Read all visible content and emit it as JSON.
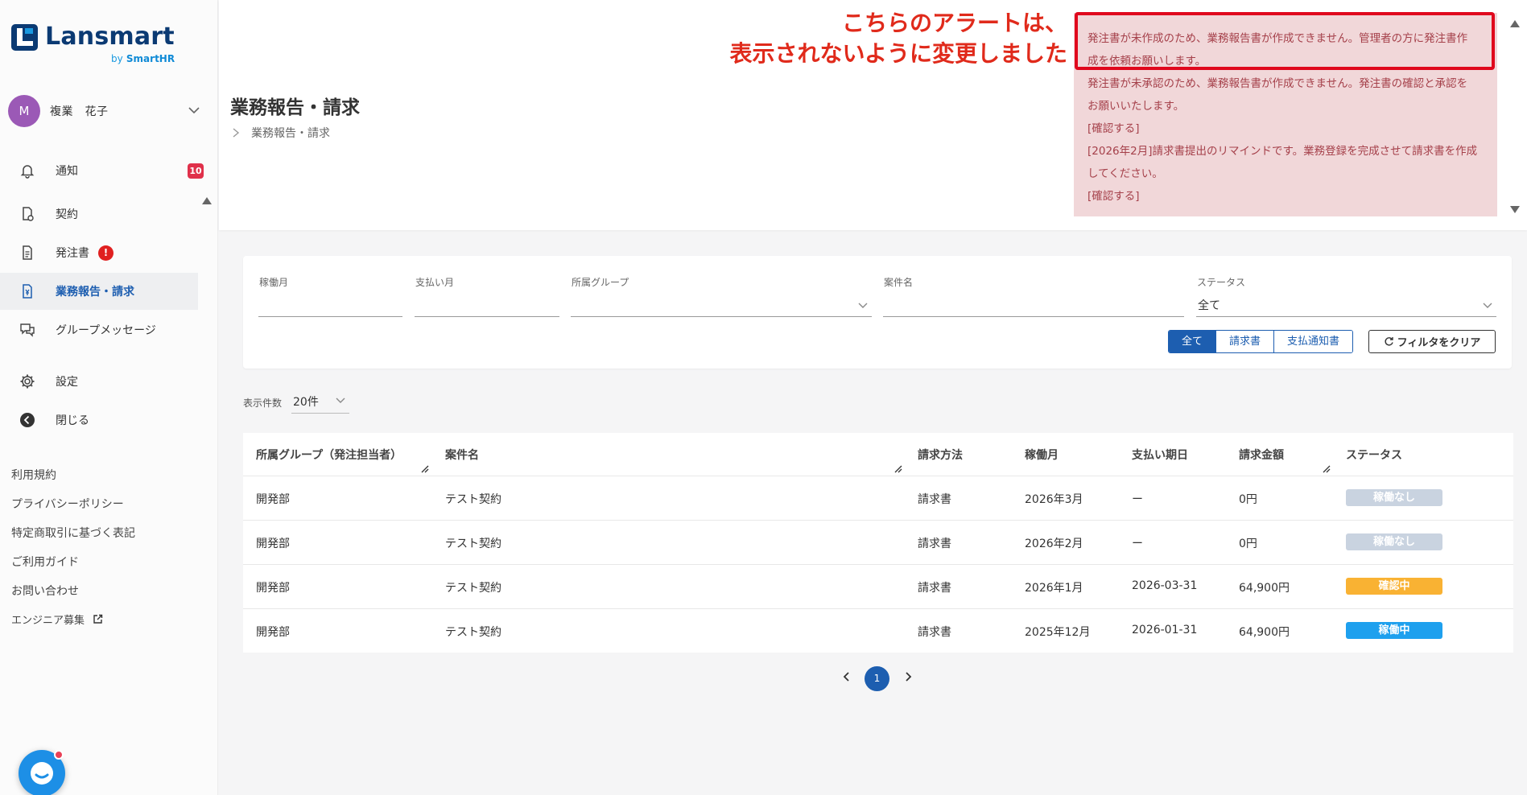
{
  "brand": {
    "name": "Lansmart",
    "sub_prefix": "by",
    "sub_name": "SmartHR",
    "color": "#0b3a73"
  },
  "user": {
    "initial": "M",
    "name": "複業　花子",
    "avatar_color": "#9b59b6"
  },
  "nav": {
    "notifications": {
      "label": "通知",
      "badge": "10"
    },
    "contracts": {
      "label": "契約"
    },
    "orders": {
      "label": "発注書",
      "badge": "!"
    },
    "reports": {
      "label": "業務報告・請求"
    },
    "group_messages": {
      "label": "グループメッセージ"
    },
    "settings": {
      "label": "設定"
    },
    "close": {
      "label": "閉じる"
    }
  },
  "footer_links": {
    "terms": "利用規約",
    "privacy": "プライバシーポリシー",
    "commerce": "特定商取引に基づく表記",
    "guide": "ご利用ガイド",
    "contact": "お問い合わせ",
    "engineers": "エンジニア募集"
  },
  "page": {
    "title": "業務報告・請求",
    "breadcrumb": "業務報告・請求"
  },
  "annotation": {
    "line1": "こちらのアラートは、",
    "line2": "表示されないように変更しました",
    "color": "#e02a1b"
  },
  "alerts": {
    "a1_line1": "発注書が未作成のため、業務報告書が作成できません。管理者の方に発注書作",
    "a1_line2": "成を依頼お願いします。",
    "a2_line1": "発注書が未承認のため、業務報告書が作成できません。発注書の確認と承認を",
    "a2_line2": "お願いいたします。",
    "a2_link": "[確認する]",
    "a3_line1": "[2026年2月]請求書提出のリマインドです。業務登録を完成させて請求書を作成",
    "a3_line2": "してください。",
    "a3_link": "[確認する]"
  },
  "filters": {
    "work_month": {
      "label": "稼働月",
      "value": ""
    },
    "pay_month": {
      "label": "支払い月",
      "value": ""
    },
    "group": {
      "label": "所属グループ",
      "value": ""
    },
    "project": {
      "label": "案件名",
      "value": ""
    },
    "status": {
      "label": "ステータス",
      "value": "全て"
    }
  },
  "segments": {
    "all": "全て",
    "invoice": "請求書",
    "payment_notice": "支払通知書"
  },
  "clear_filter": "フィルタをクリア",
  "per_page": {
    "label": "表示件数",
    "value": "20件"
  },
  "table": {
    "headers": {
      "group": "所属グループ（発注担当者）",
      "project": "案件名",
      "method": "請求方法",
      "month": "稼働月",
      "due": "支払い期日",
      "amount": "請求金額",
      "status": "ステータス"
    },
    "rows": [
      {
        "group": "開発部",
        "project": "テスト契約",
        "method": "請求書",
        "month": "2026年3月",
        "due": "ー",
        "amount": "0円",
        "status": "稼働なし",
        "status_color": "#c9d3e0"
      },
      {
        "group": "開発部",
        "project": "テスト契約",
        "method": "請求書",
        "month": "2026年2月",
        "due": "ー",
        "amount": "0円",
        "status": "稼働なし",
        "status_color": "#c9d3e0"
      },
      {
        "group": "開発部",
        "project": "テスト契約",
        "method": "請求書",
        "month": "2026年1月",
        "due": "2026-03-31",
        "amount": "64,900円",
        "status": "確認中",
        "status_color": "#f9b233"
      },
      {
        "group": "開発部",
        "project": "テスト契約",
        "method": "請求書",
        "month": "2025年12月",
        "due": "2026-01-31",
        "amount": "64,900円",
        "status": "稼働中",
        "status_color": "#1ea0ee"
      }
    ]
  },
  "pagination": {
    "current": "1"
  },
  "colors": {
    "primary": "#1d5eb0",
    "alert_bg": "#f1d7d9",
    "alert_text": "#a5404a",
    "alert_border": "#e0081d"
  }
}
